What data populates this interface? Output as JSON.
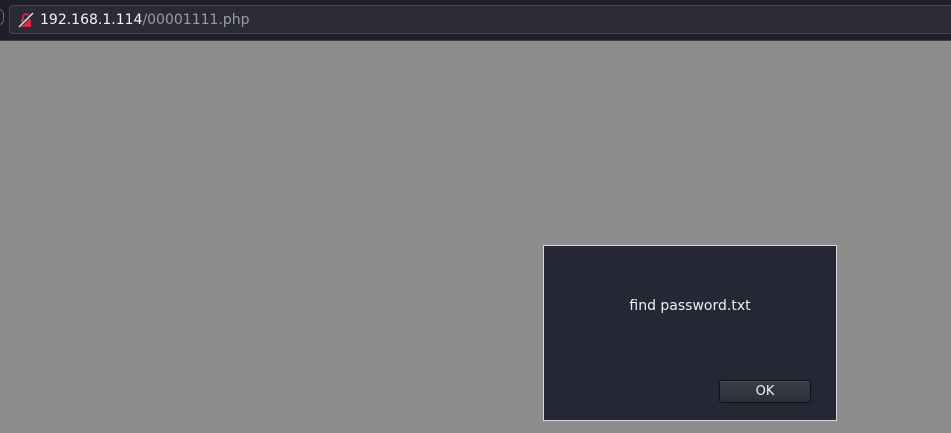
{
  "address_bar": {
    "host": "192.168.1.114",
    "path": "/00001111.php",
    "security_icon": "insecure-lock-icon"
  },
  "alert": {
    "message": "find password.txt",
    "ok_label": "OK"
  },
  "colors": {
    "page_background": "#8c8c8c",
    "toolbar_background": "#1e1f29",
    "dialog_background": "#252734",
    "insecure_icon": "#d7284a"
  }
}
